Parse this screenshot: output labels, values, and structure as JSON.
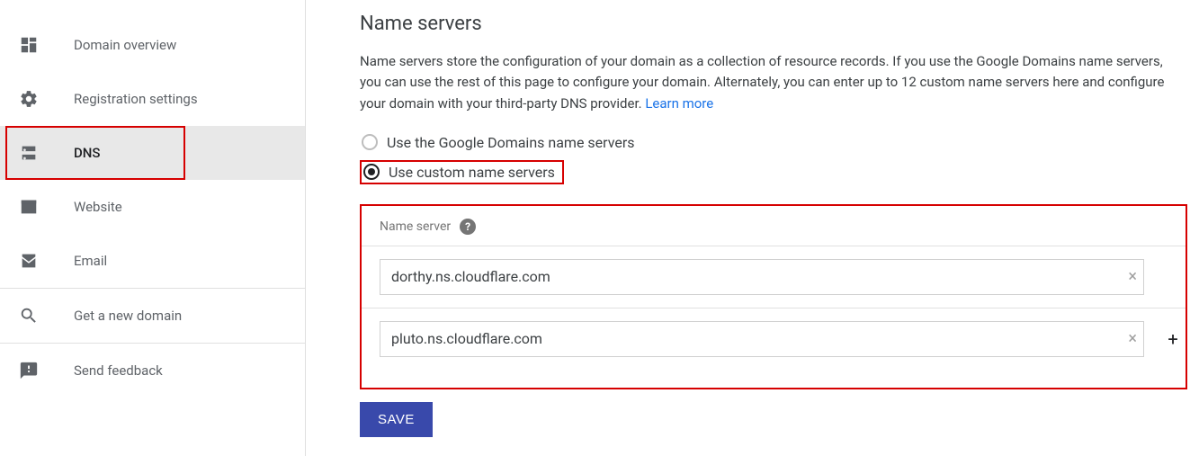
{
  "sidebar": {
    "items": [
      {
        "label": "Domain overview"
      },
      {
        "label": "Registration settings"
      },
      {
        "label": "DNS"
      },
      {
        "label": "Website"
      },
      {
        "label": "Email"
      },
      {
        "label": "Get a new domain"
      },
      {
        "label": "Send feedback"
      }
    ]
  },
  "main": {
    "heading": "Name servers",
    "description": "Name servers store the configuration of your domain as a collection of resource records. If you use the Google Domains name servers, you can use the rest of this page to configure your domain. Alternately, you can enter up to 12 custom name servers here and configure your domain with your third-party DNS provider. ",
    "learn_more": "Learn more",
    "radio_google": "Use the Google Domains name servers",
    "radio_custom": "Use custom name servers",
    "ns_label": "Name server",
    "name_servers": [
      "dorthy.ns.cloudflare.com",
      "pluto.ns.cloudflare.com"
    ],
    "save_label": "SAVE"
  }
}
